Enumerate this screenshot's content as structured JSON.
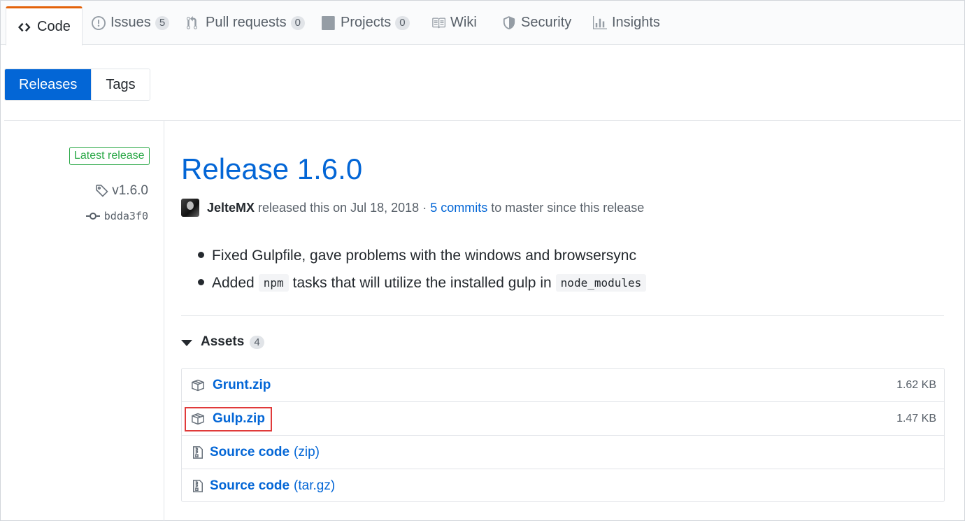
{
  "tabs": [
    {
      "label": "Code",
      "icon": "code-icon",
      "count": null,
      "selected": true
    },
    {
      "label": "Issues",
      "icon": "issue-opened-icon",
      "count": "5",
      "selected": false
    },
    {
      "label": "Pull requests",
      "icon": "git-pull-request-icon",
      "count": "0",
      "selected": false
    },
    {
      "label": "Projects",
      "icon": "project-icon",
      "count": "0",
      "selected": false
    },
    {
      "label": "Wiki",
      "icon": "book-icon",
      "count": null,
      "selected": false
    },
    {
      "label": "Security",
      "icon": "shield-icon",
      "count": null,
      "selected": false
    },
    {
      "label": "Insights",
      "icon": "graph-icon",
      "count": null,
      "selected": false
    }
  ],
  "subnav": {
    "releases_label": "Releases",
    "tags_label": "Tags",
    "selected": "Releases"
  },
  "sidebar": {
    "latest_badge": "Latest release",
    "tag": "v1.6.0",
    "commit": "bdda3f0"
  },
  "release": {
    "title": "Release 1.6.0",
    "author": "JelteMX",
    "released_text": "released this on Jul 18, 2018 ·",
    "commits_link": "5 commits",
    "since_text": "to master since this release",
    "notes": {
      "item1": "Fixed Gulpfile, gave problems with the windows and browsersync",
      "item2_before": "Added",
      "item2_code1": "npm",
      "item2_middle": "tasks that will utilize the installed gulp in",
      "item2_code2": "node_modules"
    }
  },
  "assets": {
    "heading": "Assets",
    "count": "4",
    "items": [
      {
        "name": "Grunt.zip",
        "format": "",
        "size": "1.62 KB",
        "icon": "package-icon"
      },
      {
        "name": "Gulp.zip",
        "format": "",
        "size": "1.47 KB",
        "icon": "package-icon"
      },
      {
        "name": "Source code",
        "format": "(zip)",
        "size": "",
        "icon": "file-zip-icon"
      },
      {
        "name": "Source code",
        "format": "(tar.gz)",
        "size": "",
        "icon": "file-zip-icon"
      }
    ]
  },
  "colors": {
    "accent": "#0366d6",
    "tab_active_border": "#e36209",
    "latest_badge": "#28a745",
    "highlight_box": "#e03a3a"
  }
}
